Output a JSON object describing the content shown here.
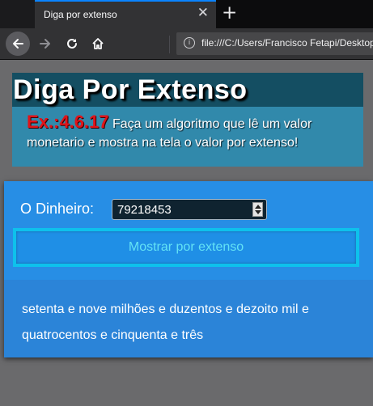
{
  "browser": {
    "tab_title": "Diga por extenso",
    "close_glyph": "✕",
    "new_tab_glyph": "+",
    "url": "file:///C:/Users/Francisco Fetapi/Desktop/",
    "icons": {
      "back": "arrow-left-icon",
      "forward": "arrow-right-icon",
      "reload": "reload-icon",
      "home": "home-icon",
      "info": "info-icon"
    }
  },
  "header": {
    "title": "Diga Por Extenso",
    "exercise_code": "Ex.:4.6.17",
    "description": " Faça um algoritmo que lê um valor monetario e mostra na tela o valor por extenso!"
  },
  "form": {
    "money_label": "O Dinheiro:",
    "money_value": "79218453",
    "show_button_label": "Mostrar por extenso"
  },
  "result": {
    "text": "setenta e nove milhões e duzentos e dezoito mil e quatrocentos e cinquenta e três"
  },
  "colors": {
    "header_band": "#144e62",
    "header_box": "#3189ab",
    "exercise_code": "#e0141a",
    "panel": "#278ee5",
    "button_border": "#0ec1ec",
    "button_text": "#62e2f5"
  }
}
